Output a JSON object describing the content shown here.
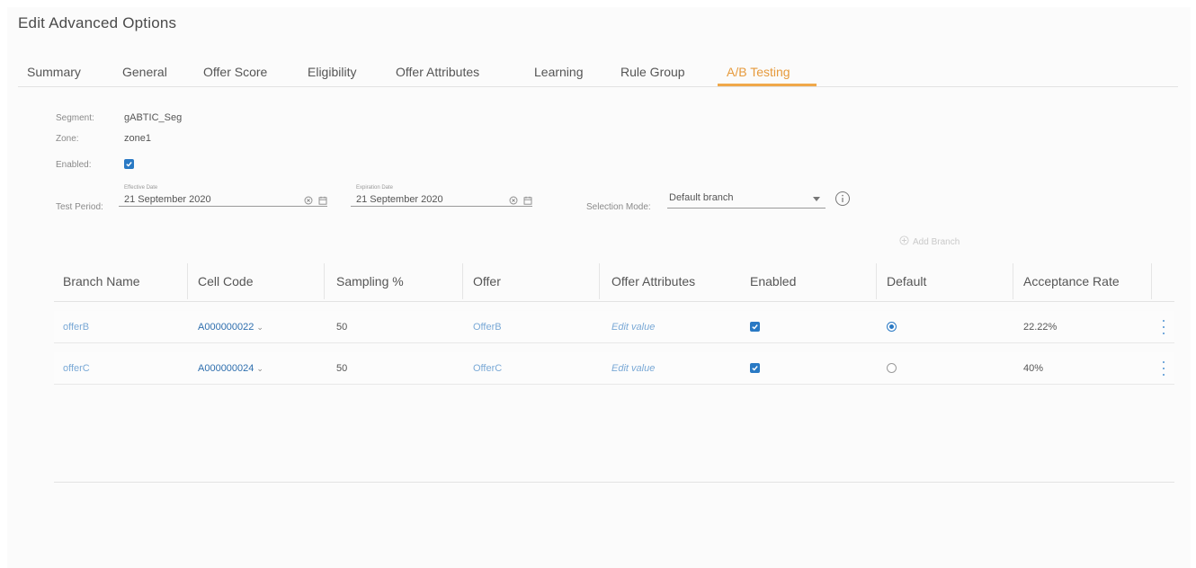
{
  "page": {
    "title": "Edit Advanced Options"
  },
  "tabs": [
    {
      "label": "Summary"
    },
    {
      "label": "General"
    },
    {
      "label": "Offer Score"
    },
    {
      "label": "Eligibility"
    },
    {
      "label": "Offer Attributes"
    },
    {
      "label": "Learning"
    },
    {
      "label": "Rule Group"
    },
    {
      "label": "A/B Testing",
      "active": true
    }
  ],
  "details": {
    "segment_label": "Segment:",
    "segment_value": "gABTIC_Seg",
    "zone_label": "Zone:",
    "zone_value": "zone1",
    "enabled_label": "Enabled:",
    "enabled_checked": true,
    "test_period_label": "Test Period:",
    "effective_date_label": "Effective Date",
    "effective_date_value": "21 September 2020",
    "expiration_date_label": "Expiration Date",
    "expiration_date_value": "21 September 2020",
    "selection_mode_label": "Selection Mode:",
    "selection_mode_value": "Default branch"
  },
  "actions": {
    "add_branch_label": "Add Branch"
  },
  "table": {
    "headers": [
      "Branch Name",
      "Cell Code",
      "Sampling %",
      "Offer",
      "Offer Attributes",
      "Enabled",
      "Default",
      "Acceptance Rate"
    ],
    "rows": [
      {
        "branch": "offerB",
        "cell_code": "A000000022",
        "sampling": "50",
        "offer": "OfferB",
        "attributes": "Edit value",
        "enabled": true,
        "default": true,
        "acceptance": "22.22%"
      },
      {
        "branch": "offerC",
        "cell_code": "A000000024",
        "sampling": "50",
        "offer": "OfferC",
        "attributes": "Edit value",
        "enabled": true,
        "default": false,
        "acceptance": "40%"
      }
    ]
  },
  "colors": {
    "accent": "#e69a3c",
    "primary": "#2979c4",
    "link": "#7aa9d6"
  }
}
